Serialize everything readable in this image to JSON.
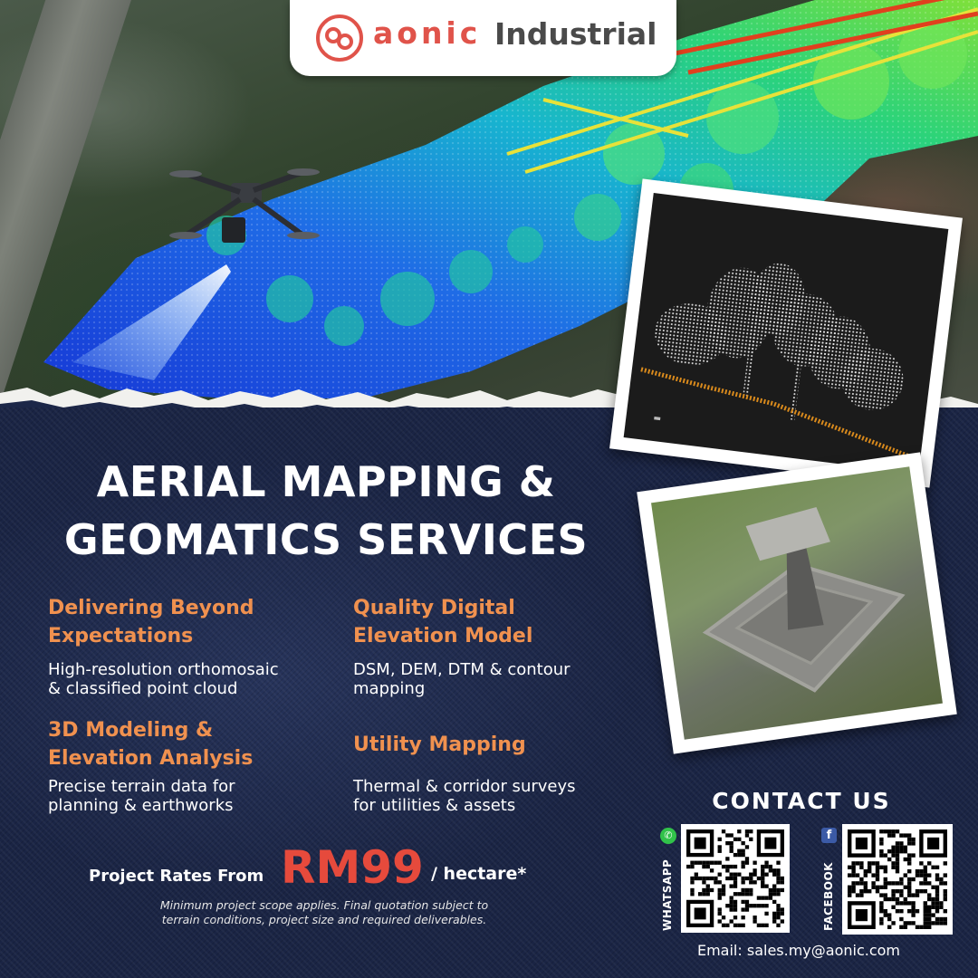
{
  "brand": {
    "logo_text": "aonic",
    "division": "Industrial",
    "colors": {
      "accent": "#e0534a",
      "text_gray": "#4a4a4a"
    }
  },
  "headline": {
    "line1": "AERIAL MAPPING &",
    "line2": "GEOMATICS SERVICES"
  },
  "services": [
    {
      "title_line1": "Delivering Beyond",
      "title_line2": "Expectations",
      "desc_line1": "High-resolution orthomosaic",
      "desc_line2": "& classified point cloud"
    },
    {
      "title_line1": "Quality Digital",
      "title_line2": "Elevation Model",
      "desc_line1": "DSM, DEM, DTM & contour",
      "desc_line2": "mapping"
    },
    {
      "title_line1": "3D Modeling &",
      "title_line2": "Elevation Analysis",
      "desc_line1": "Precise terrain data for",
      "desc_line2": "planning & earthworks"
    },
    {
      "title_line1": "Utility Mapping",
      "title_line2": "",
      "desc_line1": "Thermal & corridor surveys",
      "desc_line2": "for utilities & assets"
    }
  ],
  "pricing": {
    "prefix": "Project Rates From",
    "amount": "RM99",
    "unit": "/ hectare*",
    "note_line1": "Minimum project scope applies. Final quotation subject to",
    "note_line2": "terrain conditions, project size and required deliverables."
  },
  "contact": {
    "heading": "CONTACT US",
    "whatsapp_label": "WHATSAPP",
    "facebook_label": "FACEBOOK",
    "email": "Email: sales.my@aonic.com"
  },
  "colors": {
    "highlight_orange": "#f0914f",
    "price_red": "#e64a3c",
    "denim_blue": "#1c2748",
    "whatsapp_green": "#31c24a",
    "facebook_blue": "#3b5aa6"
  },
  "icons": [
    "aonic-logo-icon",
    "drone-icon",
    "whatsapp-icon",
    "facebook-icon",
    "qr-code-icon"
  ]
}
